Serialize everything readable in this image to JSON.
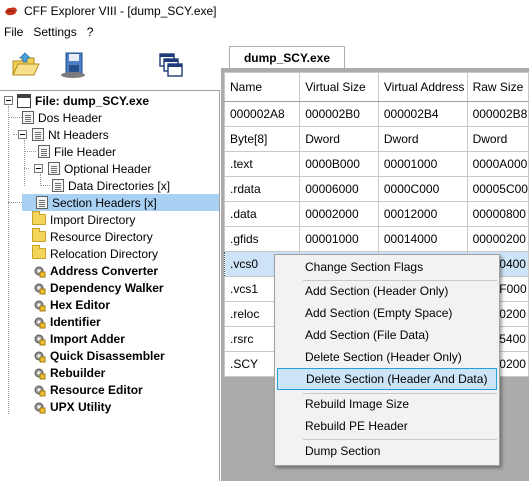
{
  "window": {
    "title": "CFF Explorer VIII - [dump_SCY.exe]"
  },
  "menu": [
    "File",
    "Settings",
    "?"
  ],
  "toolbar": {
    "buttons": [
      {
        "name": "open-icon"
      },
      {
        "name": "save-icon"
      },
      {
        "name": "windows-icon"
      }
    ]
  },
  "tree": {
    "root": "File: dump_SCY.exe",
    "dos_header": "Dos Header",
    "nt_headers": "Nt Headers",
    "file_header": "File Header",
    "optional_header": "Optional Header",
    "data_directories": "Data Directories [x]",
    "section_headers": "Section Headers [x]",
    "import_directory": "Import Directory",
    "resource_directory": "Resource Directory",
    "relocation_directory": "Relocation Directory",
    "tools": [
      "Address Converter",
      "Dependency Walker",
      "Hex Editor",
      "Identifier",
      "Import Adder",
      "Quick Disassembler",
      "Rebuilder",
      "Resource Editor",
      "UPX Utility"
    ]
  },
  "tab": {
    "label": "dump_SCY.exe"
  },
  "grid": {
    "columns": [
      "Name",
      "Virtual Size",
      "Virtual Address",
      "Raw Size"
    ],
    "offsets": [
      "000002A8",
      "000002B0",
      "000002B4",
      "000002B8"
    ],
    "types": [
      "Byte[8]",
      "Dword",
      "Dword",
      "Dword"
    ],
    "rows": [
      [
        ".text",
        "0000B000",
        "00001000",
        "0000A000"
      ],
      [
        ".rdata",
        "00006000",
        "0000C000",
        "00005C00"
      ],
      [
        ".data",
        "00002000",
        "00012000",
        "00000800"
      ],
      [
        ".gfids",
        "00001000",
        "00014000",
        "00000200"
      ],
      [
        ".vcs0",
        "",
        "",
        "00020400"
      ],
      [
        ".vcs1",
        "",
        "",
        "0021F000"
      ],
      [
        ".reloc",
        "",
        "",
        "00000200"
      ],
      [
        ".rsrc",
        "",
        "",
        "00045400"
      ],
      [
        ".SCY",
        "",
        "",
        "00000200"
      ]
    ],
    "selected_row": 4
  },
  "context_menu": {
    "items": [
      "Change Section Flags",
      "Add Section (Header Only)",
      "Add Section (Empty Space)",
      "Add Section (File Data)",
      "Delete Section (Header Only)",
      "Delete Section (Header And Data)",
      "Rebuild Image Size",
      "Rebuild PE Header",
      "Dump Section"
    ],
    "highlighted": 5
  },
  "colors": {
    "selection": "#a9d1f3",
    "menu_highlight": "#cce4f7",
    "menu_highlight_border": "#26a0da",
    "grid_background": "#ababab"
  }
}
